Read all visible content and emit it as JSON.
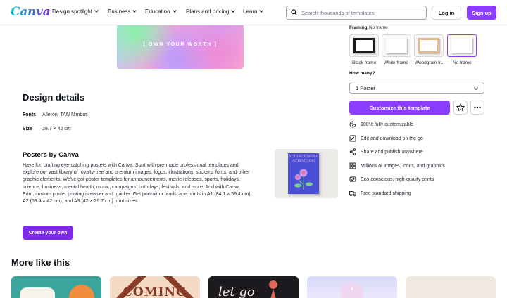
{
  "nav": {
    "logo": "Canva",
    "items": [
      "Design spotlight",
      "Business",
      "Education",
      "Plans and pricing",
      "Learn"
    ],
    "search_placeholder": "Search thousands of templates",
    "login": "Log in",
    "signup": "Sign up"
  },
  "preview": {
    "tagline": "[ OWN YOUR WORTH ]"
  },
  "details": {
    "heading": "Design details",
    "fonts_label": "Fonts",
    "fonts_value": "Aileron, TAN Nimbus",
    "size_label": "Size",
    "size_value": "29.7 × 42 cm"
  },
  "posters": {
    "heading": "Posters by Canva",
    "description": "Have fun crafting eye-catching posters with Canva. Start with pre-made professional templates and explore our vast library of royalty-free and premium images, logos, illustrations, stickers, fonts, and other graphic elements. We've got poster templates for announcements, movie releases, sports, holidays, science, business, mental health, music, campaigns, birthdays, festivals, and more. And with Canva Print, custom poster printing is easier and quicker. Get portrait or landscape prints in A1 (84.1 × 59.4 cm), A2 (59.4 × 42 cm), and A3 (42 × 29.7 cm) print sizes.",
    "create_button": "Create your own",
    "poster_text": "ATTRACT MORE ATTENTION"
  },
  "more": {
    "heading": "More like this",
    "thumbs": [
      {
        "bg": "#3aa59c"
      },
      {
        "bg": "#f4d9c4",
        "text": "COMING"
      },
      {
        "bg": "#1c1a1e",
        "text": "let go"
      },
      {
        "bg": "#e4e6fb"
      },
      {
        "bg": "#efe9e1"
      }
    ]
  },
  "panel": {
    "framing_label": "Framing",
    "framing_value": "No frame",
    "frames": [
      {
        "label": "Black frame",
        "color": "#1a1a1a"
      },
      {
        "label": "White frame",
        "color": "#ffffff"
      },
      {
        "label": "Woodgrain fr...",
        "color": "#e3b98c"
      },
      {
        "label": "No frame",
        "color": "none"
      }
    ],
    "howmany_label": "How many?",
    "quantity": "1 Poster",
    "customize_button": "Customize this template",
    "features": [
      {
        "icon": "customize-icon",
        "text": "100% fully customizable"
      },
      {
        "icon": "edit-icon",
        "text": "Edit and download on the go"
      },
      {
        "icon": "share-icon",
        "text": "Share and publish anywhere"
      },
      {
        "icon": "grid-icon",
        "text": "Millions of images, icons, and graphics"
      },
      {
        "icon": "eco-icon",
        "text": "Eco-conscious, high-quality prints"
      },
      {
        "icon": "truck-icon",
        "text": "Free standard shipping"
      }
    ]
  },
  "colors": {
    "brand": "#8b3dff",
    "brand_dark": "#7d2ae8"
  }
}
